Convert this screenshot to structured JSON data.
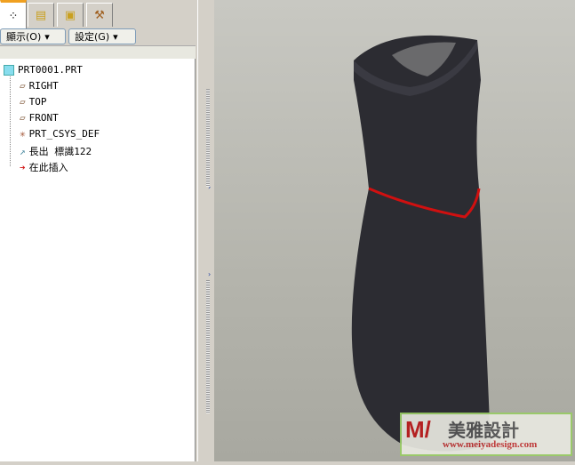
{
  "tabs": [
    "model-tree",
    "layers",
    "folder",
    "tools"
  ],
  "toolbar": {
    "show_label": "顯示(O)",
    "settings_label": "設定(G)"
  },
  "tree": {
    "root": "PRT0001.PRT",
    "items": [
      {
        "label": "RIGHT",
        "icon": "datum-plane"
      },
      {
        "label": "TOP",
        "icon": "datum-plane"
      },
      {
        "label": "FRONT",
        "icon": "datum-plane"
      },
      {
        "label": "PRT_CSYS_DEF",
        "icon": "coordinate-system"
      },
      {
        "label": "長出 標識122",
        "icon": "protrusion"
      },
      {
        "label": "在此插入",
        "icon": "insert-here-arrow"
      }
    ]
  },
  "watermark": {
    "brand": "美雅設計",
    "url": "www.meiyadesign.com"
  },
  "colors": {
    "model": "#2c2c32",
    "edge": "#d01010"
  }
}
